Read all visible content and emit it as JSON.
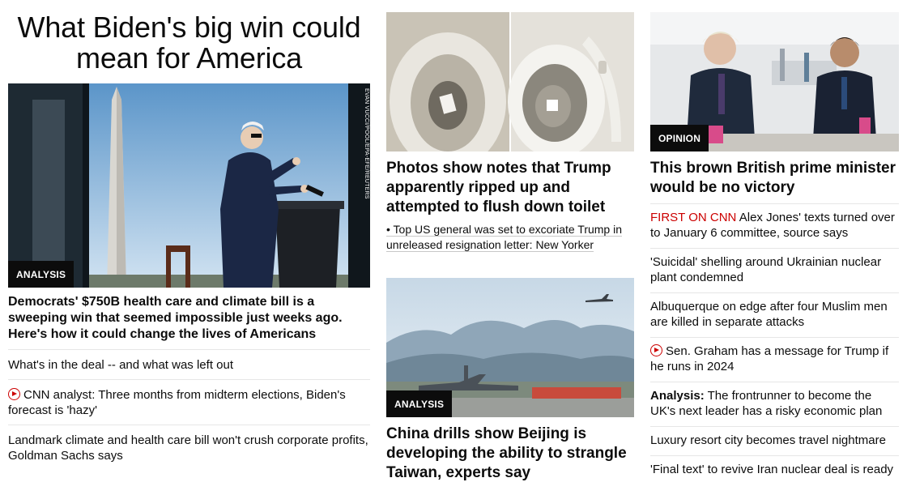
{
  "col1": {
    "title": "What Biden's big win could mean for America",
    "photo_credit": "EVAN VUCCI/POOL/EPA-EFE/REUTERS",
    "badge": "ANALYSIS",
    "headline": "Democrats' $750B health care and climate bill is a sweeping win that seemed impossible just weeks ago. Here's how it could change the lives of Americans",
    "links": [
      {
        "text": "What's in the deal -- and what was left out"
      },
      {
        "text": "CNN analyst: Three months from midterm elections, Biden's forecast is 'hazy'",
        "icon": "play-icon"
      },
      {
        "text": "Landmark climate and health care bill won't crush corporate profits, Goldman Sachs says"
      }
    ]
  },
  "col2": {
    "story1": {
      "headline": "Photos show notes that Trump apparently ripped up and attempted to flush down toilet",
      "sub": "• Top US general was set to excoriate Trump in unreleased resignation letter: New Yorker"
    },
    "story2": {
      "badge": "ANALYSIS",
      "headline": "China drills show Beijing is developing the ability to strangle Taiwan, experts say"
    }
  },
  "col3": {
    "badge": "OPINION",
    "headline": "This brown British prime minister would be no victory",
    "links": [
      {
        "prefix": "FIRST ON CNN",
        "text": " Alex Jones' texts turned over to January 6 committee, source says"
      },
      {
        "text": "'Suicidal' shelling around Ukrainian nuclear plant condemned"
      },
      {
        "text": "Albuquerque on edge after four Muslim men are killed in separate attacks"
      },
      {
        "text": "Sen. Graham has a message for Trump if he runs in 2024",
        "icon": "play-icon"
      },
      {
        "prefix": "Analysis:",
        "text": " The frontrunner to become the UK's next leader has a risky economic plan"
      },
      {
        "text": "Luxury resort city becomes travel nightmare"
      },
      {
        "text": "'Final text' to revive Iran nuclear deal is ready"
      }
    ]
  },
  "colors": {
    "text": "#0c0c0c",
    "accent_red": "#cc0000",
    "divider": "#e6e6e6",
    "badge_bg": "#0c0c0c"
  }
}
